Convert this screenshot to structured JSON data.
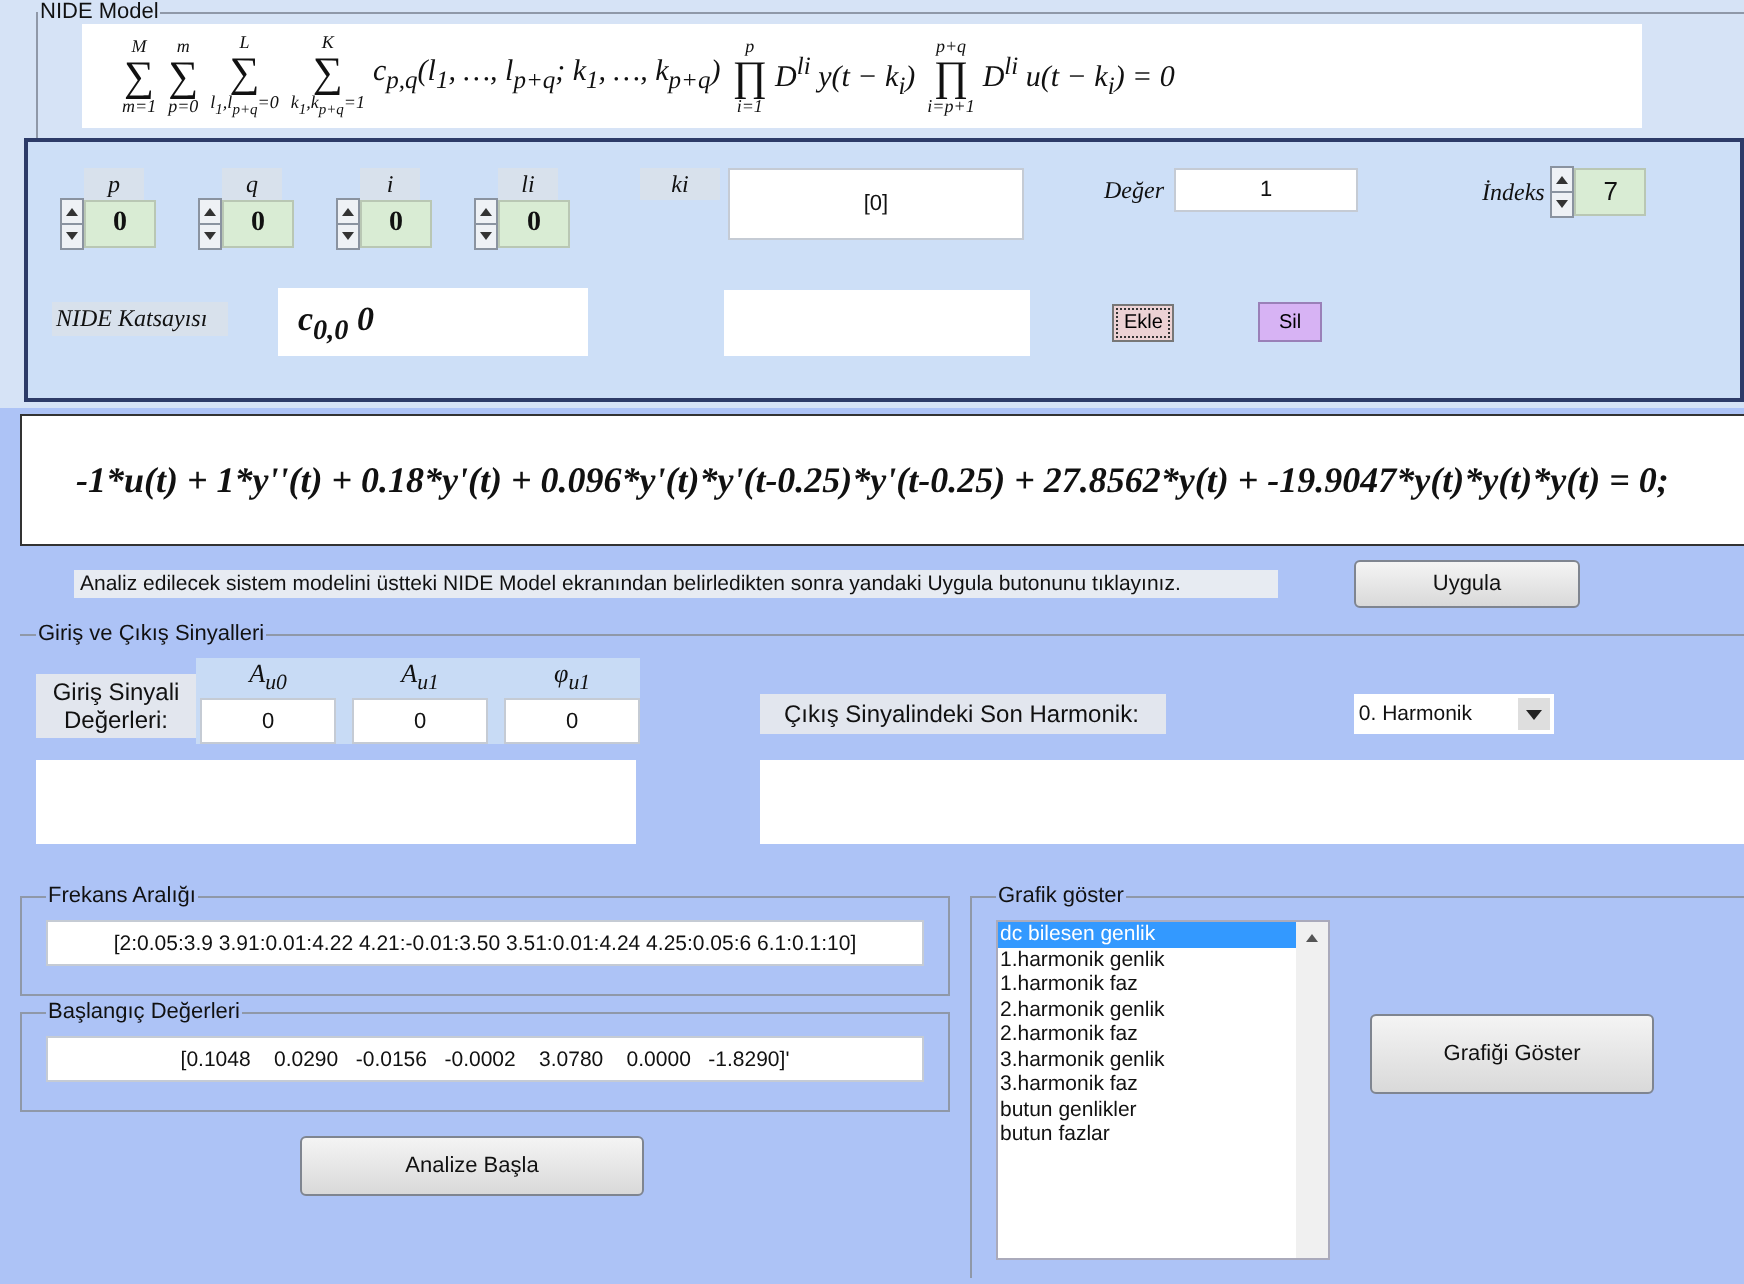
{
  "nide_model": {
    "title": "NIDE Model",
    "formula": {
      "sums": [
        {
          "symbol": "∑",
          "upper": "M",
          "lower": "m=1"
        },
        {
          "symbol": "∑",
          "upper": "m",
          "lower": "p=0"
        },
        {
          "symbol": "∑",
          "upper": "L",
          "lower": "l$_{1}$,l$_{p+q}$=0"
        },
        {
          "symbol": "∑",
          "upper": "K",
          "lower": "k$_{1}$,k$_{p+q}$=1"
        }
      ],
      "coefficient": "c$_{p,q}$(l$_{1}$, …, l$_{p+q}$; k$_{1}$, …, k$_{p+q}$)",
      "products": [
        {
          "symbol": "∏",
          "upper": "p",
          "lower": "i=1",
          "term": "D$^{li}$ y(t − k$_{i}$)"
        },
        {
          "symbol": "∏",
          "upper": "p+q",
          "lower": "i=p+1",
          "term": "D$^{li}$ u(t − k$_{i}$) = 0"
        }
      ]
    },
    "spinners": [
      {
        "label": "p",
        "value": "0"
      },
      {
        "label": "q",
        "value": "0"
      },
      {
        "label": "i",
        "value": "0"
      },
      {
        "label": "li",
        "value": "0"
      }
    ],
    "ki": {
      "label": "ki",
      "value": "[0]"
    },
    "deger": {
      "label": "Değer",
      "value": "1"
    },
    "indeks": {
      "label": "İndeks",
      "value": "7"
    },
    "katsayi": {
      "label": "NIDE Katsayısı",
      "value": "c$_{0,0}$ 0"
    },
    "buttons": [
      {
        "label": "Ekle",
        "kind": "focused"
      },
      {
        "label": "Sil",
        "kind": "violet"
      }
    ],
    "equation": "-1*u(t) + 1*y''(t) + 0.18*y'(t) + 0.096*y'(t)*y'(t-0.25)*y'(t-0.25) + 27.8562*y(t) + -19.9047*y(t)*y(t)*y(t) = 0;",
    "hint": "Analiz edilecek sistem modelini üstteki NIDE Model ekranından belirledikten sonra yandaki Uygula butonunu tıklayınız.",
    "apply_button": "Uygula"
  },
  "signals": {
    "title": "Giriş ve Çıkış Sinyalleri",
    "input_label": "Giriş Sinyali Değerleri:",
    "inputs": [
      {
        "label": "A$_{u0}$",
        "value": "0"
      },
      {
        "label": "A$_{u1}$",
        "value": "0"
      },
      {
        "label": "φ$_{u1}$",
        "value": "0"
      }
    ],
    "output_label": "Çıkış Sinyalindeki Son Harmonik:",
    "harmonic": "0. Harmonik"
  },
  "frequency": {
    "title": "Frekans Aralığı",
    "value": "[2:0.05:3.9 3.91:0.01:4.22 4.21:-0.01:3.50 3.51:0.01:4.24 4.25:0.05:6 6.1:0.1:10]"
  },
  "initial": {
    "title": "Başlangıç Değerleri",
    "value": "[0.1048    0.0290   -0.0156   -0.0002    3.0780    0.0000   -1.8290]'"
  },
  "analyze_button": "Analize Başla",
  "graph": {
    "title": "Grafik göster",
    "items": [
      {
        "label": "dc bilesen genlik",
        "selected": true
      },
      {
        "label": "1.harmonik genlik",
        "selected": false
      },
      {
        "label": "1.harmonik faz",
        "selected": false
      },
      {
        "label": "2.harmonik genlik",
        "selected": false
      },
      {
        "label": "2.harmonik faz",
        "selected": false
      },
      {
        "label": "3.harmonik genlik",
        "selected": false
      },
      {
        "label": "3.harmonik faz",
        "selected": false
      },
      {
        "label": "butun genlikler",
        "selected": false
      },
      {
        "label": "butun fazlar",
        "selected": false
      }
    ],
    "button": "Grafiği Göster"
  }
}
